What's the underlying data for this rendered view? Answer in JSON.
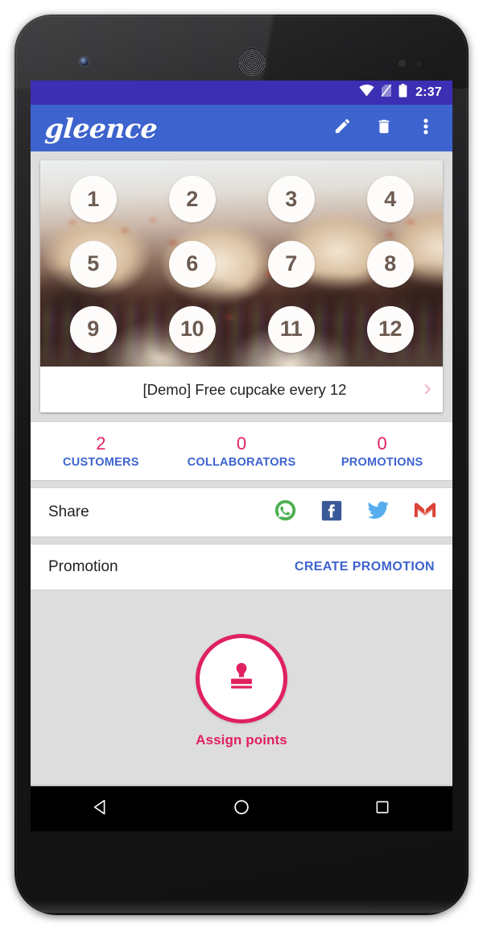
{
  "status_bar": {
    "time": "2:37",
    "icons": [
      "wifi-icon",
      "no-sim-icon",
      "battery-icon"
    ]
  },
  "app_bar": {
    "logo_text": "gleence",
    "actions": [
      {
        "name": "edit-button",
        "icon": "pencil-icon"
      },
      {
        "name": "delete-button",
        "icon": "trash-icon"
      },
      {
        "name": "overflow-menu-button",
        "icon": "more-vertical-icon"
      }
    ]
  },
  "stamp_card": {
    "title": "[Demo] Free cupcake every 12",
    "chevron": "›",
    "stamps": [
      "1",
      "2",
      "3",
      "4",
      "5",
      "6",
      "7",
      "8",
      "9",
      "10",
      "11",
      "12"
    ],
    "photo_alt": "cupcakes-photo"
  },
  "stats": [
    {
      "value": "2",
      "label": "CUSTOMERS"
    },
    {
      "value": "0",
      "label": "COLLABORATORS"
    },
    {
      "value": "0",
      "label": "PROMOTIONS"
    }
  ],
  "share": {
    "label": "Share",
    "targets": [
      {
        "name": "share-whatsapp",
        "icon": "whatsapp-icon"
      },
      {
        "name": "share-facebook",
        "icon": "facebook-icon"
      },
      {
        "name": "share-twitter",
        "icon": "twitter-icon"
      },
      {
        "name": "share-gmail",
        "icon": "gmail-icon"
      }
    ]
  },
  "promotion": {
    "label": "Promotion",
    "action_label": "CREATE PROMOTION"
  },
  "assign": {
    "label": "Assign points",
    "icon": "stamp-icon"
  },
  "nav_bar": {
    "back": "back-triangle-icon",
    "home": "home-circle-icon",
    "recents": "recents-square-icon"
  },
  "colors": {
    "status_bar": "#3C2FB4",
    "app_bar": "#3D63CE",
    "accent_pink": "#E0215F",
    "accent_blue": "#3D63CE",
    "page_bg": "#DDDDDD",
    "stamp_number": "#6D5B51"
  }
}
